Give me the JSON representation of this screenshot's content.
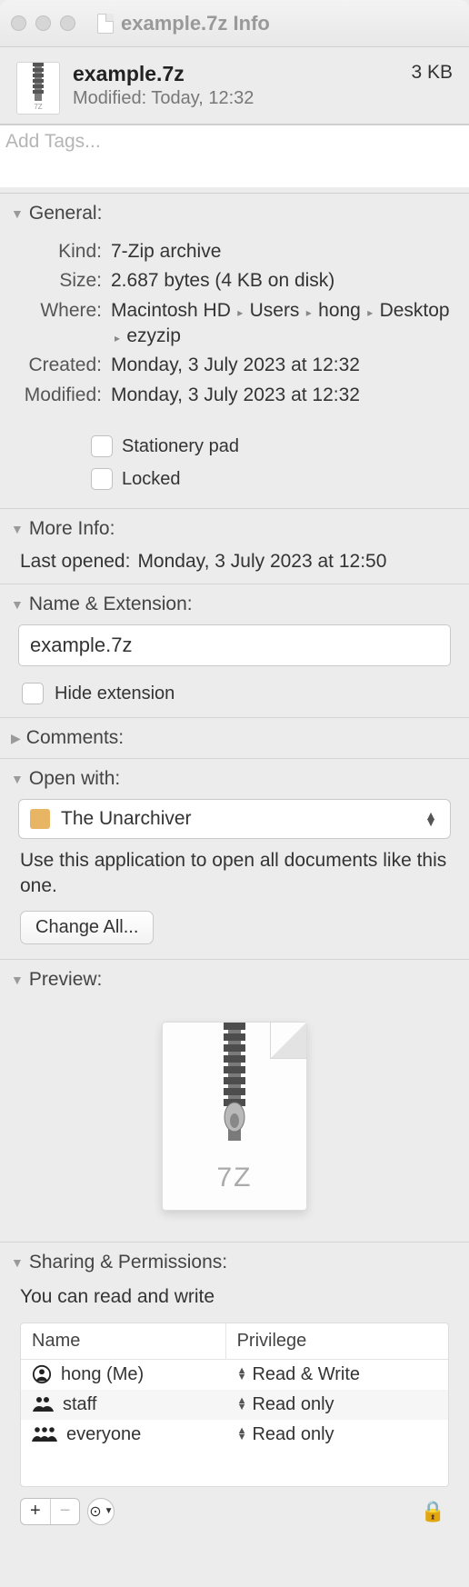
{
  "titlebar": {
    "title": "example.7z Info"
  },
  "header": {
    "filename": "example.7z",
    "modified_label": "Modified:",
    "modified_value": "Today, 12:32",
    "filesize": "3 KB",
    "mini_ext": "7Z"
  },
  "tags": {
    "placeholder": "Add Tags..."
  },
  "general": {
    "title": "General:",
    "kind_label": "Kind:",
    "kind_value": "7-Zip archive",
    "size_label": "Size:",
    "size_value": "2.687 bytes (4 KB on disk)",
    "where_label": "Where:",
    "where_parts": [
      "Macintosh HD",
      "Users",
      "hong",
      "Desktop",
      "ezyzip"
    ],
    "created_label": "Created:",
    "created_value": "Monday, 3 July 2023 at 12:32",
    "modified_label": "Modified:",
    "modified_value": "Monday, 3 July 2023 at 12:32",
    "stationery_label": "Stationery pad",
    "locked_label": "Locked"
  },
  "more_info": {
    "title": "More Info:",
    "last_opened_label": "Last opened:",
    "last_opened_value": "Monday, 3 July 2023 at 12:50"
  },
  "name_ext": {
    "title": "Name & Extension:",
    "value": "example.7z",
    "hide_label": "Hide extension"
  },
  "comments": {
    "title": "Comments:"
  },
  "open_with": {
    "title": "Open with:",
    "app": "The Unarchiver",
    "desc": "Use this application to open all documents like this one.",
    "change_all": "Change All..."
  },
  "preview": {
    "title": "Preview:",
    "ext": "7Z"
  },
  "sharing": {
    "title": "Sharing & Permissions:",
    "desc": "You can read and write",
    "col_name": "Name",
    "col_priv": "Privilege",
    "rows": [
      {
        "name": "hong (Me)",
        "priv": "Read & Write"
      },
      {
        "name": "staff",
        "priv": "Read only"
      },
      {
        "name": "everyone",
        "priv": "Read only"
      }
    ]
  }
}
